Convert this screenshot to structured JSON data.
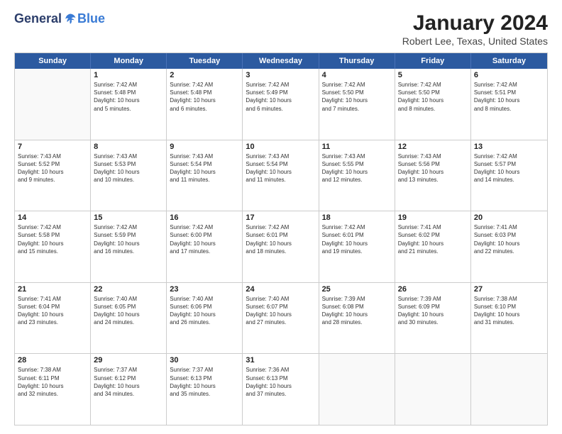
{
  "logo": {
    "general": "General",
    "blue": "Blue"
  },
  "title": "January 2024",
  "subtitle": "Robert Lee, Texas, United States",
  "header_days": [
    "Sunday",
    "Monday",
    "Tuesday",
    "Wednesday",
    "Thursday",
    "Friday",
    "Saturday"
  ],
  "weeks": [
    [
      {
        "day": "",
        "info": ""
      },
      {
        "day": "1",
        "info": "Sunrise: 7:42 AM\nSunset: 5:48 PM\nDaylight: 10 hours\nand 5 minutes."
      },
      {
        "day": "2",
        "info": "Sunrise: 7:42 AM\nSunset: 5:48 PM\nDaylight: 10 hours\nand 6 minutes."
      },
      {
        "day": "3",
        "info": "Sunrise: 7:42 AM\nSunset: 5:49 PM\nDaylight: 10 hours\nand 6 minutes."
      },
      {
        "day": "4",
        "info": "Sunrise: 7:42 AM\nSunset: 5:50 PM\nDaylight: 10 hours\nand 7 minutes."
      },
      {
        "day": "5",
        "info": "Sunrise: 7:42 AM\nSunset: 5:50 PM\nDaylight: 10 hours\nand 8 minutes."
      },
      {
        "day": "6",
        "info": "Sunrise: 7:42 AM\nSunset: 5:51 PM\nDaylight: 10 hours\nand 8 minutes."
      }
    ],
    [
      {
        "day": "7",
        "info": "Sunrise: 7:43 AM\nSunset: 5:52 PM\nDaylight: 10 hours\nand 9 minutes."
      },
      {
        "day": "8",
        "info": "Sunrise: 7:43 AM\nSunset: 5:53 PM\nDaylight: 10 hours\nand 10 minutes."
      },
      {
        "day": "9",
        "info": "Sunrise: 7:43 AM\nSunset: 5:54 PM\nDaylight: 10 hours\nand 11 minutes."
      },
      {
        "day": "10",
        "info": "Sunrise: 7:43 AM\nSunset: 5:54 PM\nDaylight: 10 hours\nand 11 minutes."
      },
      {
        "day": "11",
        "info": "Sunrise: 7:43 AM\nSunset: 5:55 PM\nDaylight: 10 hours\nand 12 minutes."
      },
      {
        "day": "12",
        "info": "Sunrise: 7:43 AM\nSunset: 5:56 PM\nDaylight: 10 hours\nand 13 minutes."
      },
      {
        "day": "13",
        "info": "Sunrise: 7:42 AM\nSunset: 5:57 PM\nDaylight: 10 hours\nand 14 minutes."
      }
    ],
    [
      {
        "day": "14",
        "info": "Sunrise: 7:42 AM\nSunset: 5:58 PM\nDaylight: 10 hours\nand 15 minutes."
      },
      {
        "day": "15",
        "info": "Sunrise: 7:42 AM\nSunset: 5:59 PM\nDaylight: 10 hours\nand 16 minutes."
      },
      {
        "day": "16",
        "info": "Sunrise: 7:42 AM\nSunset: 6:00 PM\nDaylight: 10 hours\nand 17 minutes."
      },
      {
        "day": "17",
        "info": "Sunrise: 7:42 AM\nSunset: 6:01 PM\nDaylight: 10 hours\nand 18 minutes."
      },
      {
        "day": "18",
        "info": "Sunrise: 7:42 AM\nSunset: 6:01 PM\nDaylight: 10 hours\nand 19 minutes."
      },
      {
        "day": "19",
        "info": "Sunrise: 7:41 AM\nSunset: 6:02 PM\nDaylight: 10 hours\nand 21 minutes."
      },
      {
        "day": "20",
        "info": "Sunrise: 7:41 AM\nSunset: 6:03 PM\nDaylight: 10 hours\nand 22 minutes."
      }
    ],
    [
      {
        "day": "21",
        "info": "Sunrise: 7:41 AM\nSunset: 6:04 PM\nDaylight: 10 hours\nand 23 minutes."
      },
      {
        "day": "22",
        "info": "Sunrise: 7:40 AM\nSunset: 6:05 PM\nDaylight: 10 hours\nand 24 minutes."
      },
      {
        "day": "23",
        "info": "Sunrise: 7:40 AM\nSunset: 6:06 PM\nDaylight: 10 hours\nand 26 minutes."
      },
      {
        "day": "24",
        "info": "Sunrise: 7:40 AM\nSunset: 6:07 PM\nDaylight: 10 hours\nand 27 minutes."
      },
      {
        "day": "25",
        "info": "Sunrise: 7:39 AM\nSunset: 6:08 PM\nDaylight: 10 hours\nand 28 minutes."
      },
      {
        "day": "26",
        "info": "Sunrise: 7:39 AM\nSunset: 6:09 PM\nDaylight: 10 hours\nand 30 minutes."
      },
      {
        "day": "27",
        "info": "Sunrise: 7:38 AM\nSunset: 6:10 PM\nDaylight: 10 hours\nand 31 minutes."
      }
    ],
    [
      {
        "day": "28",
        "info": "Sunrise: 7:38 AM\nSunset: 6:11 PM\nDaylight: 10 hours\nand 32 minutes."
      },
      {
        "day": "29",
        "info": "Sunrise: 7:37 AM\nSunset: 6:12 PM\nDaylight: 10 hours\nand 34 minutes."
      },
      {
        "day": "30",
        "info": "Sunrise: 7:37 AM\nSunset: 6:13 PM\nDaylight: 10 hours\nand 35 minutes."
      },
      {
        "day": "31",
        "info": "Sunrise: 7:36 AM\nSunset: 6:13 PM\nDaylight: 10 hours\nand 37 minutes."
      },
      {
        "day": "",
        "info": ""
      },
      {
        "day": "",
        "info": ""
      },
      {
        "day": "",
        "info": ""
      }
    ]
  ]
}
